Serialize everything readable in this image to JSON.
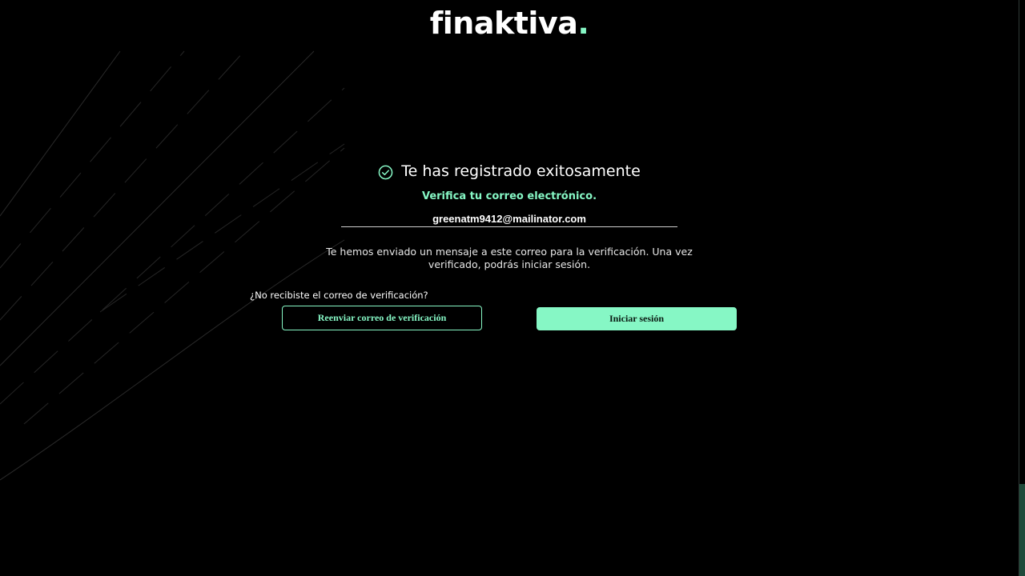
{
  "brand": {
    "logo_text": "finaktiva",
    "logo_dot": ".",
    "accent_color": "#86f7c5",
    "background_color": "#000000"
  },
  "success": {
    "icon": "check-circle-icon",
    "title": "Te has registrado exitosamente",
    "subtitle": "Verifica tu correo electrónico."
  },
  "email": {
    "value": "greenatm9412@mailinator.com"
  },
  "message": "Te hemos enviado un mensaje a este correo para la verificación. Una vez verificado, podrás iniciar sesión.",
  "resend": {
    "question": "¿No recibiste el correo de verificación?",
    "button_label": "Reenviar correo de verificación"
  },
  "login": {
    "button_label": "Iniciar sesión"
  }
}
